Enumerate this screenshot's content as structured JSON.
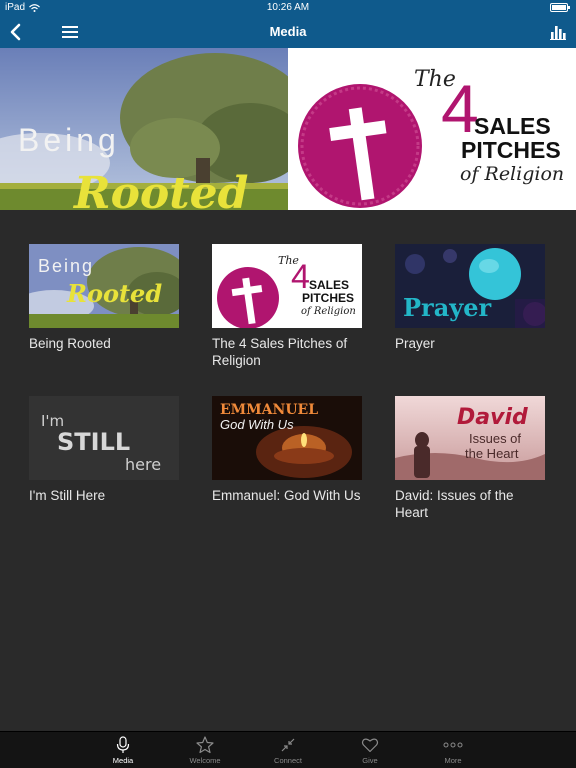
{
  "status_bar": {
    "device": "iPad",
    "time": "10:26 AM"
  },
  "nav": {
    "title": "Media"
  },
  "hero": {
    "left": {
      "line1": "Being",
      "line2": "Rooted"
    },
    "right": {
      "the": "The",
      "number": "4",
      "line1": "SALES",
      "line2": "PITCHES",
      "line3": "of Religion"
    }
  },
  "items": [
    {
      "title": "Being Rooted",
      "art_l1": "Being",
      "art_l2": "Rooted"
    },
    {
      "title": "The 4 Sales Pitches of Religion",
      "art_the": "The",
      "art_num": "4",
      "art_l1": "SALES",
      "art_l2": "PITCHES",
      "art_l3": "of Religion"
    },
    {
      "title": "Prayer",
      "art_l1": "Prayer"
    },
    {
      "title": "I'm Still Here",
      "art_l1": "I'm",
      "art_l2": "STILL",
      "art_l3": "here"
    },
    {
      "title": "Emmanuel: God With Us",
      "art_l1": "EMMANUEL",
      "art_l2": "God With Us"
    },
    {
      "title": "David: Issues of the Heart",
      "art_l1": "David",
      "art_l2": "Issues of",
      "art_l3": "the Heart"
    }
  ],
  "tabs": [
    {
      "label": "Media",
      "icon": "microphone-icon",
      "active": true
    },
    {
      "label": "Welcome",
      "icon": "star-icon"
    },
    {
      "label": "Connect",
      "icon": "connect-arrows-icon"
    },
    {
      "label": "Give",
      "icon": "heart-icon"
    },
    {
      "label": "More",
      "icon": "more-dots-icon"
    }
  ],
  "colors": {
    "bar": "#0f5a8c",
    "background": "#2a2a2a",
    "tabbar": "#141414",
    "accent_magenta": "#b0156f"
  }
}
